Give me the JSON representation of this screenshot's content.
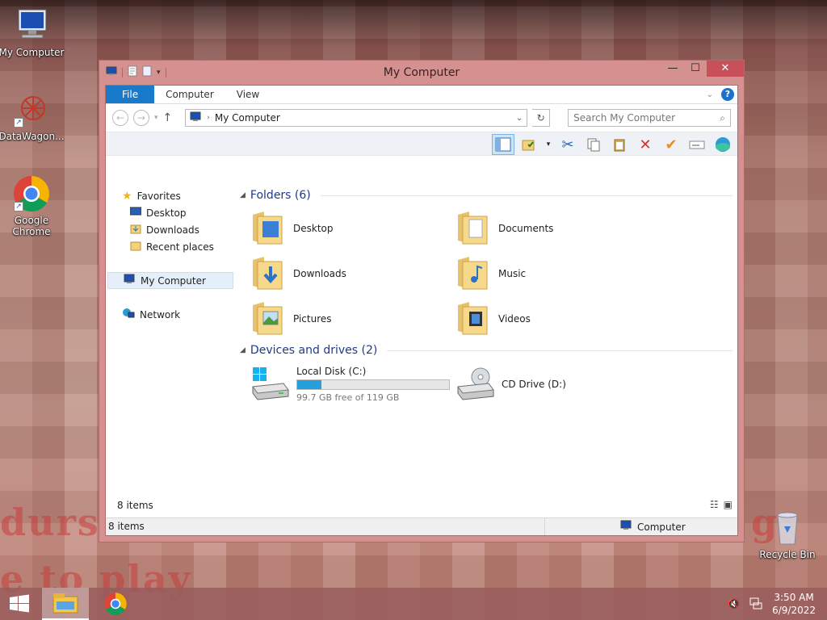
{
  "desktop": {
    "icons": [
      {
        "label": "My Computer"
      },
      {
        "label": "DataWagon..."
      },
      {
        "label": "Google Chrome"
      },
      {
        "label": "Recycle Bin"
      }
    ],
    "bg_text": [
      "durst",
      "e to play",
      "g"
    ]
  },
  "window": {
    "title": "My Computer",
    "ribbon": {
      "file": "File",
      "computer": "Computer",
      "view": "View",
      "help": "?"
    },
    "address": {
      "path": "My Computer",
      "separator": "›"
    },
    "search": {
      "placeholder": "Search My Computer"
    },
    "nav": {
      "favorites": "Favorites",
      "desktop": "Desktop",
      "downloads": "Downloads",
      "recent": "Recent places",
      "my_computer": "My Computer",
      "network": "Network"
    },
    "folders_header": "Folders (6)",
    "folders": [
      {
        "name": "Desktop",
        "icon": "folder-desktop-icon"
      },
      {
        "name": "Documents",
        "icon": "folder-documents-icon"
      },
      {
        "name": "Downloads",
        "icon": "folder-downloads-icon"
      },
      {
        "name": "Music",
        "icon": "folder-music-icon"
      },
      {
        "name": "Pictures",
        "icon": "folder-pictures-icon"
      },
      {
        "name": "Videos",
        "icon": "folder-videos-icon"
      }
    ],
    "drives_header": "Devices and drives (2)",
    "drives": [
      {
        "name": "Local Disk (C:)",
        "free": "99.7 GB free of 119 GB",
        "used_fraction": 0.162
      },
      {
        "name": "CD Drive (D:)"
      }
    ],
    "status_items": "8 items",
    "status_bar_items": "8 items",
    "status_bar_location": "Computer"
  },
  "taskbar": {
    "time": "3:50 AM",
    "date": "6/9/2022"
  },
  "colors": {
    "accent": "#1979ca",
    "drive_bar": "#26a0da",
    "close": "#c7505a"
  }
}
